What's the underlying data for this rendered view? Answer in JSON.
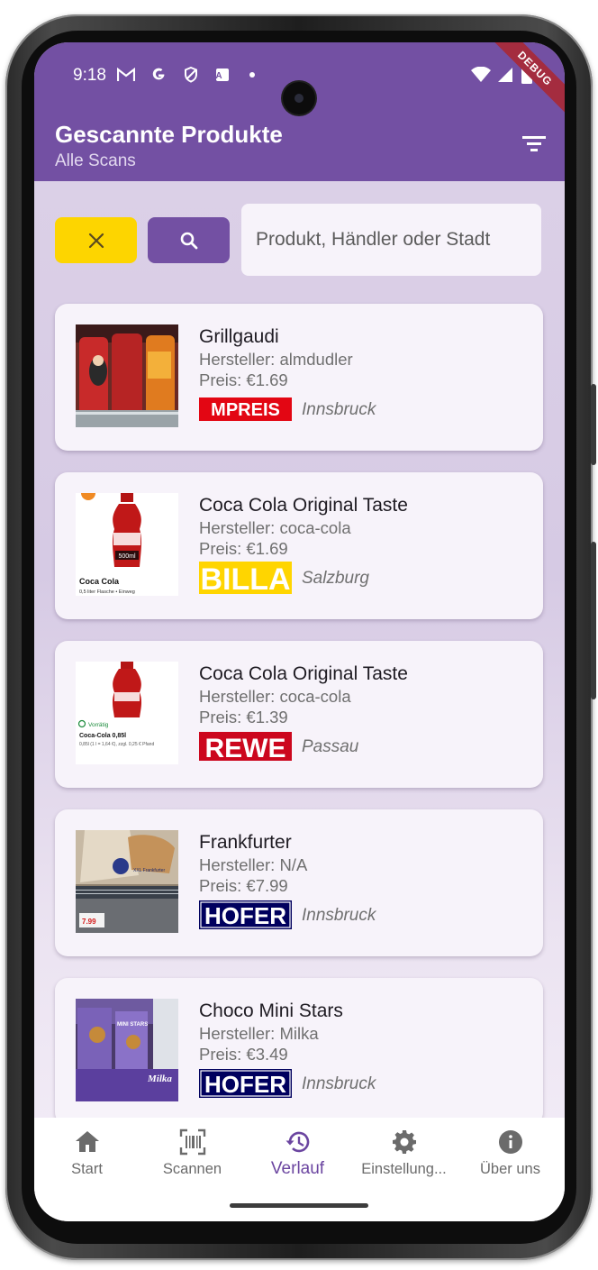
{
  "status_bar": {
    "time": "9:18",
    "left_icons": [
      "gmail-icon",
      "google-icon",
      "shield-icon",
      "translate-icon",
      "dot-icon"
    ],
    "right_icons": [
      "wifi-icon",
      "signal-icon",
      "battery-icon"
    ],
    "debug_label": "DEBUG"
  },
  "appbar": {
    "title": "Gescannte Produkte",
    "subtitle": "Alle Scans",
    "filter_icon": "filter-icon"
  },
  "search": {
    "clear_icon": "close-icon",
    "search_icon": "search-icon",
    "placeholder": "Produkt, Händler oder Stadt",
    "value": ""
  },
  "products": [
    {
      "name": "Grillgaudi",
      "maker": "Hersteller: almdudler",
      "price": "Preis: €1.69",
      "store": "MPREIS",
      "city": "Innsbruck"
    },
    {
      "name": "Coca Cola Original Taste",
      "maker": "Hersteller: coca-cola",
      "price": "Preis: €1.69",
      "store": "BILLA",
      "city": "Salzburg",
      "thumb_text": "Coca Cola",
      "thumb_sub": "0,5 liter Flasche • Einweg",
      "bottle_label": "500ml"
    },
    {
      "name": "Coca Cola Original Taste",
      "maker": "Hersteller: coca-cola",
      "price": "Preis: €1.39",
      "store": "REWE",
      "city": "Passau",
      "thumb_badge": "Vorrätig",
      "thumb_text": "Coca-Cola 0,85l",
      "thumb_sub": "0,85l (1 l = 1,64 €), zzgl. 0,25 € Pfand"
    },
    {
      "name": "Frankfurter",
      "maker": "Hersteller: N/A",
      "price": "Preis: €7.99",
      "store": "HOFER",
      "city": "Innsbruck",
      "thumb_text": "XXL Frankfurter",
      "price_tag": "7.99"
    },
    {
      "name": "Choco Mini Stars",
      "maker": "Hersteller: Milka",
      "price": "Preis: €3.49",
      "store": "HOFER",
      "city": "Innsbruck",
      "thumb_text": "Milka",
      "pack_text": "MINI STARS"
    }
  ],
  "nav": [
    {
      "label": "Start",
      "icon": "home-icon",
      "active": false
    },
    {
      "label": "Scannen",
      "icon": "barcode-scan-icon",
      "active": false
    },
    {
      "label": "Verlauf",
      "icon": "history-icon",
      "active": true
    },
    {
      "label": "Einstellung...",
      "icon": "settings-gear-icon",
      "active": false
    },
    {
      "label": "Über uns",
      "icon": "info-icon",
      "active": false
    }
  ],
  "colors": {
    "primary": "#7350a3",
    "accent_yellow": "#fdd500",
    "card_bg": "#f7f3fa",
    "mpreis_red": "#e30613",
    "billa_yellow": "#ffd500",
    "rewe_red": "#cc071e",
    "hofer_navy": "#00005e"
  }
}
